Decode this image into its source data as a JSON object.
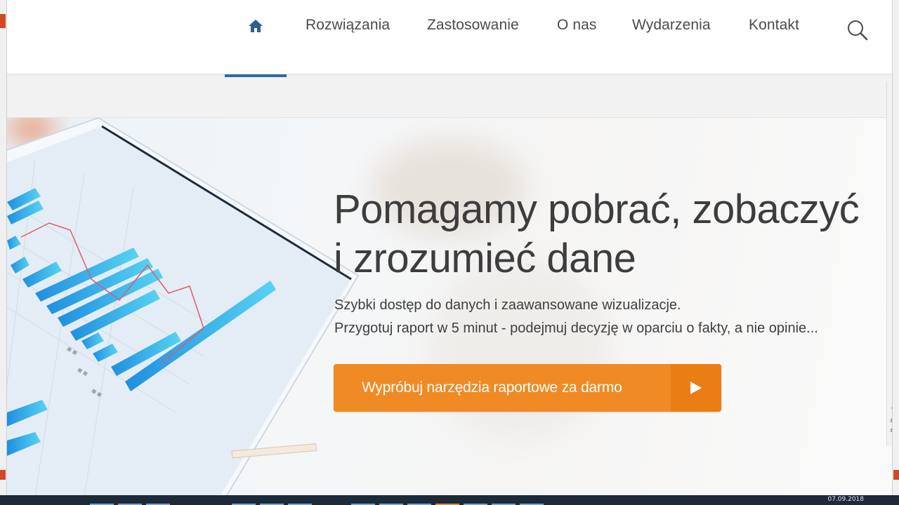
{
  "nav": {
    "home_icon": "home-icon",
    "items": [
      {
        "label": "Rozwiązania"
      },
      {
        "label": "Zastosowanie"
      },
      {
        "label": "O nas"
      },
      {
        "label": "Wydarzenia"
      },
      {
        "label": "Kontakt"
      }
    ],
    "search_icon": "search-icon"
  },
  "hero": {
    "headline_line1": "Pomagamy pobrać, zobaczyć",
    "headline_line2": "i zrozumieć dane",
    "sub_line1": "Szybki dostęp do danych i zaawansowane wizualizacje.",
    "sub_line2": "Przygotuj raport w 5 minut - podejmuj decyzję w oparciu o fakty, a nie opinie...",
    "cta_label": "Wypróbuj narzędzia raportowe za darmo",
    "cta_icon": "play-arrow-icon"
  },
  "taskbar": {
    "date": "07.09.2018"
  },
  "colors": {
    "accent": "#f08a24",
    "accent_dark": "#ea7d14",
    "nav_active": "#2f6aa6",
    "text": "#3d3d3d"
  }
}
